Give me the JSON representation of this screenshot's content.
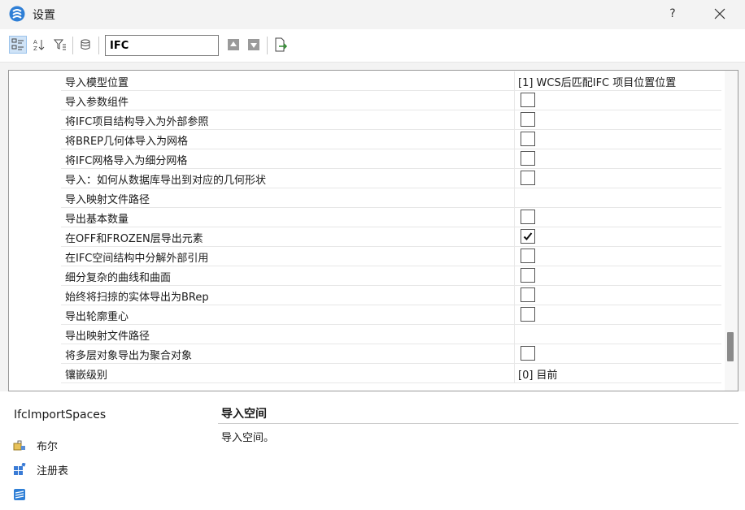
{
  "window": {
    "title": "设置",
    "help_label": "?"
  },
  "toolbar": {
    "search_value": "IFC"
  },
  "grid": {
    "rows": [
      {
        "name": "导入模型位置",
        "value": "[1] WCS后匹配IFC 项目位置位置"
      },
      {
        "name": "导入参数组件",
        "checked": false
      },
      {
        "name": "将IFC项目结构导入为外部参照",
        "checked": false
      },
      {
        "name": "将BREP几何体导入为网格",
        "checked": false
      },
      {
        "name": "将IFC网格导入为细分网格",
        "checked": false
      },
      {
        "name": "导入：如何从数据库导出到对应的几何形状",
        "checked": false
      },
      {
        "name": "导入映射文件路径",
        "value": ""
      },
      {
        "name": "导出基本数量",
        "checked": false
      },
      {
        "name": "在OFF和FROZEN层导出元素",
        "checked": true
      },
      {
        "name": "在IFC空间结构中分解外部引用",
        "checked": false
      },
      {
        "name": "细分复杂的曲线和曲面",
        "checked": false
      },
      {
        "name": "始终将扫掠的实体导出为BRep",
        "checked": false
      },
      {
        "name": "导出轮廓重心",
        "checked": false
      },
      {
        "name": "导出映射文件路径",
        "value": ""
      },
      {
        "name": "将多层对象导出为聚合对象",
        "checked": false
      },
      {
        "name": "镶嵌级别",
        "value": "[0] 目前"
      }
    ],
    "scroll_position": 0.9
  },
  "details": {
    "property_name": "IfcImportSpaces",
    "type_label": "布尔",
    "storage_label": "注册表",
    "description_title": "导入空间",
    "description_text": "导入空间。"
  },
  "colors": {
    "accent": "#0078d4",
    "selection": "#cfe3f7"
  }
}
